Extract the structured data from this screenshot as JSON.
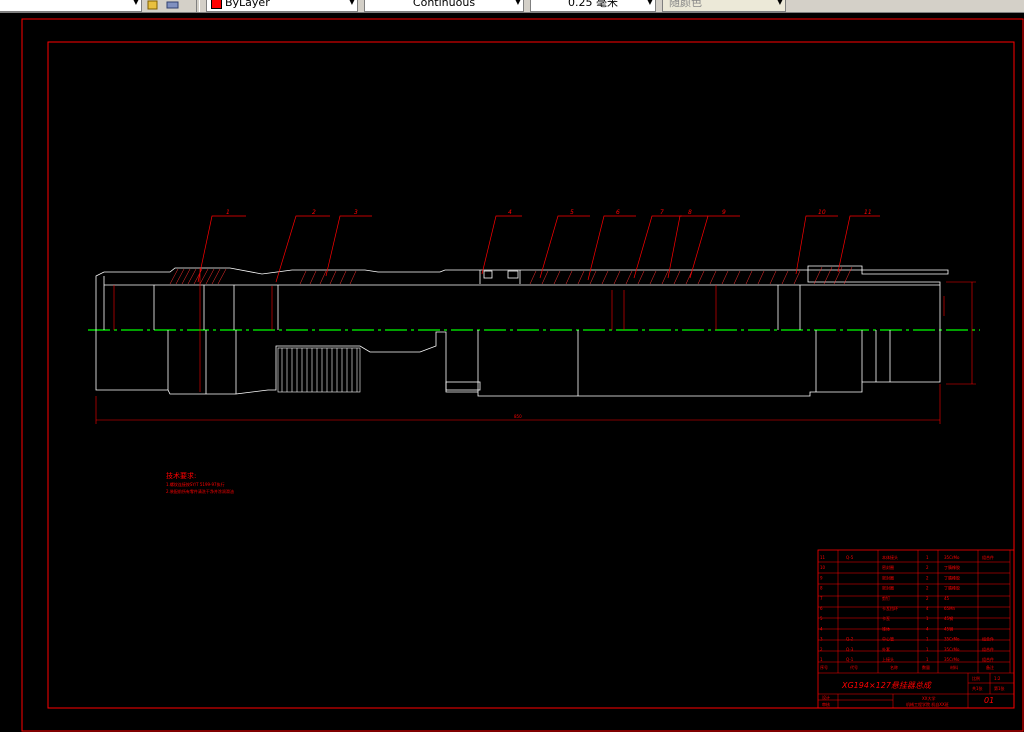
{
  "toolbar": {
    "layer_value": "ByLayer",
    "linetype_value": "Continuous",
    "lineweight_value": "0.25 毫米",
    "plotstyle_value": "随颜色"
  },
  "drawing": {
    "balloons": [
      "1",
      "2",
      "3",
      "4",
      "5",
      "6",
      "7",
      "8",
      "9",
      "10",
      "11"
    ],
    "tech_requirements": {
      "title": "技术要求:",
      "line1": "1.螺纹连接按SY/T 5199-97执行",
      "line2": "2.装配前所有零件清洗干净并涂润滑油"
    },
    "title_block": {
      "drawing_name": "XG194×127悬挂器总成",
      "drawing_no": "01",
      "rows": [
        {
          "seq": "11",
          "code": "Q-5",
          "name": "本体接头",
          "qty": "1",
          "material": "35CrMo",
          "note": "组合件"
        },
        {
          "seq": "10",
          "code": "",
          "name": "密封圈",
          "qty": "2",
          "material": "丁腈橡胶",
          "note": ""
        },
        {
          "seq": "9",
          "code": "",
          "name": "密封圈",
          "qty": "2",
          "material": "丁腈橡胶",
          "note": ""
        },
        {
          "seq": "8",
          "code": "",
          "name": "密封圈",
          "qty": "2",
          "material": "丁腈橡胶",
          "note": ""
        },
        {
          "seq": "7",
          "code": "",
          "name": "剪钉",
          "qty": "2",
          "material": "45",
          "note": ""
        },
        {
          "seq": "6",
          "code": "",
          "name": "卡瓦挡环",
          "qty": "4",
          "material": "65Mn",
          "note": ""
        },
        {
          "seq": "5",
          "code": "",
          "name": "卡瓦",
          "qty": "1",
          "material": "45钢",
          "note": ""
        },
        {
          "seq": "4",
          "code": "",
          "name": "锥体",
          "qty": "4",
          "material": "45钢",
          "note": ""
        },
        {
          "seq": "3",
          "code": "Q-2",
          "name": "中心管",
          "qty": "1",
          "material": "35CrMo",
          "note": "组合件"
        },
        {
          "seq": "2",
          "code": "Q-3",
          "name": "外套",
          "qty": "1",
          "material": "35CrMo",
          "note": "组合件"
        },
        {
          "seq": "1",
          "code": "Q-1",
          "name": "上接头",
          "qty": "1",
          "material": "35CrMo",
          "note": "组合件"
        }
      ],
      "header": {
        "seq": "序号",
        "code": "代号",
        "name": "名称",
        "qty": "数量",
        "material": "材料",
        "note": "备注"
      },
      "scale_label": "比例",
      "scale_value": "1:2",
      "sheet_label": "共1张",
      "sheet_value": "第1张",
      "designer_label": "设计",
      "checker_label": "审核",
      "school": "XX大学",
      "class": "机械工程学院  机自XX班"
    }
  },
  "colors": {
    "frame": "#ff0000",
    "centerline": "#00ff00",
    "outline": "#ffffff",
    "background": "#000000"
  }
}
